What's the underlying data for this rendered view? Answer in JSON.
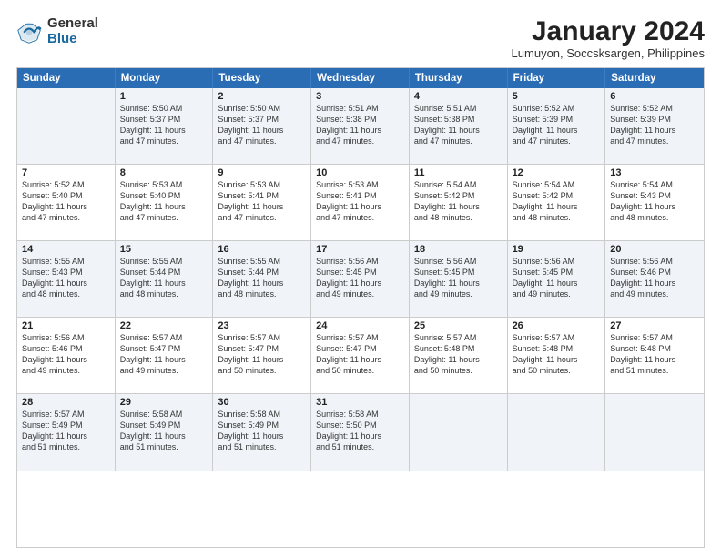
{
  "logo": {
    "general": "General",
    "blue": "Blue"
  },
  "title": "January 2024",
  "subtitle": "Lumuyon, Soccsksargen, Philippines",
  "header_days": [
    "Sunday",
    "Monday",
    "Tuesday",
    "Wednesday",
    "Thursday",
    "Friday",
    "Saturday"
  ],
  "weeks": [
    [
      {
        "day": "",
        "info": ""
      },
      {
        "day": "1",
        "info": "Sunrise: 5:50 AM\nSunset: 5:37 PM\nDaylight: 11 hours\nand 47 minutes."
      },
      {
        "day": "2",
        "info": "Sunrise: 5:50 AM\nSunset: 5:37 PM\nDaylight: 11 hours\nand 47 minutes."
      },
      {
        "day": "3",
        "info": "Sunrise: 5:51 AM\nSunset: 5:38 PM\nDaylight: 11 hours\nand 47 minutes."
      },
      {
        "day": "4",
        "info": "Sunrise: 5:51 AM\nSunset: 5:38 PM\nDaylight: 11 hours\nand 47 minutes."
      },
      {
        "day": "5",
        "info": "Sunrise: 5:52 AM\nSunset: 5:39 PM\nDaylight: 11 hours\nand 47 minutes."
      },
      {
        "day": "6",
        "info": "Sunrise: 5:52 AM\nSunset: 5:39 PM\nDaylight: 11 hours\nand 47 minutes."
      }
    ],
    [
      {
        "day": "7",
        "info": "Sunrise: 5:52 AM\nSunset: 5:40 PM\nDaylight: 11 hours\nand 47 minutes."
      },
      {
        "day": "8",
        "info": "Sunrise: 5:53 AM\nSunset: 5:40 PM\nDaylight: 11 hours\nand 47 minutes."
      },
      {
        "day": "9",
        "info": "Sunrise: 5:53 AM\nSunset: 5:41 PM\nDaylight: 11 hours\nand 47 minutes."
      },
      {
        "day": "10",
        "info": "Sunrise: 5:53 AM\nSunset: 5:41 PM\nDaylight: 11 hours\nand 47 minutes."
      },
      {
        "day": "11",
        "info": "Sunrise: 5:54 AM\nSunset: 5:42 PM\nDaylight: 11 hours\nand 48 minutes."
      },
      {
        "day": "12",
        "info": "Sunrise: 5:54 AM\nSunset: 5:42 PM\nDaylight: 11 hours\nand 48 minutes."
      },
      {
        "day": "13",
        "info": "Sunrise: 5:54 AM\nSunset: 5:43 PM\nDaylight: 11 hours\nand 48 minutes."
      }
    ],
    [
      {
        "day": "14",
        "info": "Sunrise: 5:55 AM\nSunset: 5:43 PM\nDaylight: 11 hours\nand 48 minutes."
      },
      {
        "day": "15",
        "info": "Sunrise: 5:55 AM\nSunset: 5:44 PM\nDaylight: 11 hours\nand 48 minutes."
      },
      {
        "day": "16",
        "info": "Sunrise: 5:55 AM\nSunset: 5:44 PM\nDaylight: 11 hours\nand 48 minutes."
      },
      {
        "day": "17",
        "info": "Sunrise: 5:56 AM\nSunset: 5:45 PM\nDaylight: 11 hours\nand 49 minutes."
      },
      {
        "day": "18",
        "info": "Sunrise: 5:56 AM\nSunset: 5:45 PM\nDaylight: 11 hours\nand 49 minutes."
      },
      {
        "day": "19",
        "info": "Sunrise: 5:56 AM\nSunset: 5:45 PM\nDaylight: 11 hours\nand 49 minutes."
      },
      {
        "day": "20",
        "info": "Sunrise: 5:56 AM\nSunset: 5:46 PM\nDaylight: 11 hours\nand 49 minutes."
      }
    ],
    [
      {
        "day": "21",
        "info": "Sunrise: 5:56 AM\nSunset: 5:46 PM\nDaylight: 11 hours\nand 49 minutes."
      },
      {
        "day": "22",
        "info": "Sunrise: 5:57 AM\nSunset: 5:47 PM\nDaylight: 11 hours\nand 49 minutes."
      },
      {
        "day": "23",
        "info": "Sunrise: 5:57 AM\nSunset: 5:47 PM\nDaylight: 11 hours\nand 50 minutes."
      },
      {
        "day": "24",
        "info": "Sunrise: 5:57 AM\nSunset: 5:47 PM\nDaylight: 11 hours\nand 50 minutes."
      },
      {
        "day": "25",
        "info": "Sunrise: 5:57 AM\nSunset: 5:48 PM\nDaylight: 11 hours\nand 50 minutes."
      },
      {
        "day": "26",
        "info": "Sunrise: 5:57 AM\nSunset: 5:48 PM\nDaylight: 11 hours\nand 50 minutes."
      },
      {
        "day": "27",
        "info": "Sunrise: 5:57 AM\nSunset: 5:48 PM\nDaylight: 11 hours\nand 51 minutes."
      }
    ],
    [
      {
        "day": "28",
        "info": "Sunrise: 5:57 AM\nSunset: 5:49 PM\nDaylight: 11 hours\nand 51 minutes."
      },
      {
        "day": "29",
        "info": "Sunrise: 5:58 AM\nSunset: 5:49 PM\nDaylight: 11 hours\nand 51 minutes."
      },
      {
        "day": "30",
        "info": "Sunrise: 5:58 AM\nSunset: 5:49 PM\nDaylight: 11 hours\nand 51 minutes."
      },
      {
        "day": "31",
        "info": "Sunrise: 5:58 AM\nSunset: 5:50 PM\nDaylight: 11 hours\nand 51 minutes."
      },
      {
        "day": "",
        "info": ""
      },
      {
        "day": "",
        "info": ""
      },
      {
        "day": "",
        "info": ""
      }
    ]
  ],
  "shaded_rows": [
    0,
    2,
    4
  ],
  "colors": {
    "header_bg": "#2a6db5",
    "shaded_cell": "#f0f4f8",
    "border": "#ccc"
  }
}
